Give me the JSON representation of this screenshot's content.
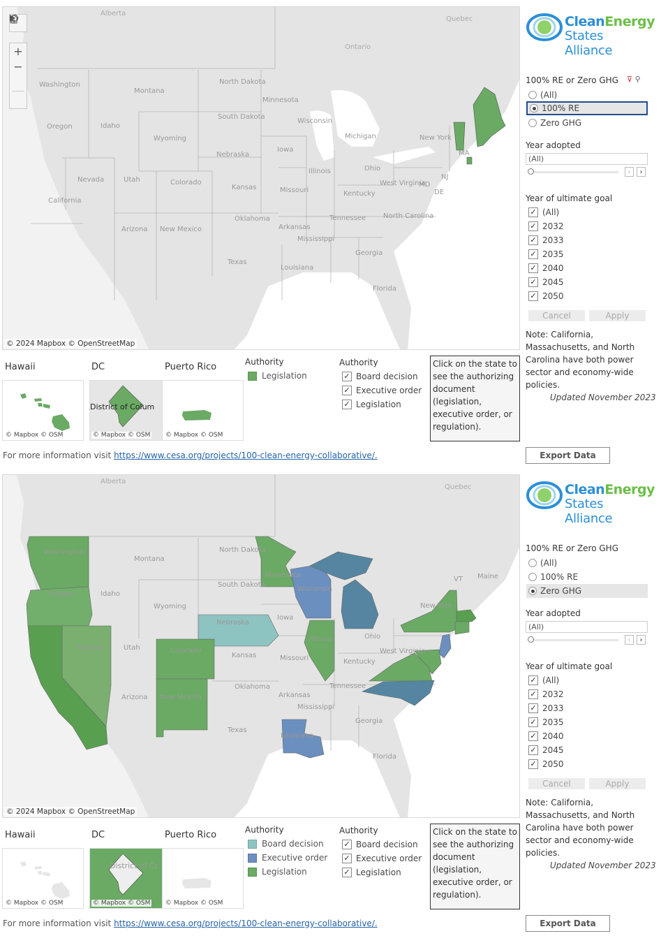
{
  "colors": {
    "legislation": "#6aaa64",
    "legislation_dark": "#58a04f",
    "executive_order": "#6b8fbf",
    "executive_order_dark": "#5585a0",
    "board_decision": "#8dc3c0",
    "map_land": "#e4e4e4",
    "map_water": "#ffffff",
    "link": "#2563a8",
    "selected_border": "#1f4e8c",
    "logo_blue": "#2c8fd6",
    "logo_green": "#6bbf47"
  },
  "logo": {
    "line1_a": "Clean",
    "line1_b": "Energy",
    "line2": "States Alliance"
  },
  "map": {
    "attribution": "© 2024 Mapbox © OpenStreetMap",
    "controls": [
      "search-icon",
      "zoom-in",
      "zoom-out",
      "home-icon",
      "play-icon"
    ],
    "country_labels": [
      "Alberta",
      "Ontario",
      "Quebec"
    ],
    "state_labels": [
      "Washington",
      "Oregon",
      "California",
      "Montana",
      "Idaho",
      "Nevada",
      "Utah",
      "Arizona",
      "Wyoming",
      "Colorado",
      "New Mexico",
      "North Dakota",
      "South Dakota",
      "Nebraska",
      "Kansas",
      "Oklahoma",
      "Texas",
      "Minnesota",
      "Iowa",
      "Missouri",
      "Arkansas",
      "Louisiana",
      "Wisconsin",
      "Illinois",
      "Michigan",
      "Ohio",
      "Kentucky",
      "Tennessee",
      "Mississippi",
      "Georgia",
      "Florida",
      "West Virginia",
      "North Carolina",
      "New York",
      "MA",
      "NJ",
      "MD",
      "DE",
      "VT",
      "Maine"
    ]
  },
  "filters": {
    "policy_type": {
      "title": "100% RE or Zero GHG",
      "options": [
        "(All)",
        "100% RE",
        "Zero GHG"
      ]
    },
    "year_adopted": {
      "title": "Year adopted",
      "value": "(All)",
      "slider_position": 0
    },
    "year_goal": {
      "title": "Year of ultimate goal",
      "options": [
        "(All)",
        "2032",
        "2033",
        "2035",
        "2040",
        "2045",
        "2050"
      ],
      "all_checked": true
    },
    "cancel_label": "Cancel",
    "apply_label": "Apply"
  },
  "note": "Note:  California, Massachusetts, and North Carolina have both power sector and economy-wide policies.",
  "updated": "Updated November 2023",
  "export_label": "Export Data",
  "insets": {
    "hawaii": "Hawaii",
    "dc": "DC",
    "puerto_rico": "Puerto Rico",
    "attribution": "© Mapbox  © OSM",
    "dc_label_1": "District of Colum",
    "dc_label_2": "District of Columbia"
  },
  "authority_filter": {
    "title": "Authority",
    "options": [
      "Board decision",
      "Executive order",
      "Legislation"
    ]
  },
  "info_box": "Click on the state to see the authorizing document (legislation, executive order, or regulation).",
  "more_info": {
    "prefix": "For more information visit ",
    "link": "https://www.cesa.org/projects/100-clean-energy-collaborative/."
  },
  "panels": [
    {
      "selected_policy": "100% RE",
      "legend_title": "Authority",
      "legend": [
        {
          "label": "Legislation",
          "color": "#6aaa64"
        }
      ],
      "highlighted_states": [
        {
          "state": "Maine",
          "authority": "Legislation"
        },
        {
          "state": "Vermont",
          "authority": "Legislation"
        },
        {
          "state": "Rhode Island",
          "authority": "Legislation"
        }
      ],
      "insets_highlighted": {
        "hawaii": true,
        "dc": true,
        "puerto_rico": true
      }
    },
    {
      "selected_policy": "Zero GHG",
      "legend_title": "Authority",
      "legend": [
        {
          "label": "Board decision",
          "color": "#8dc3c0"
        },
        {
          "label": "Executive order",
          "color": "#6b8fbf"
        },
        {
          "label": "Legislation",
          "color": "#6aaa64"
        }
      ],
      "highlighted_states": [
        {
          "state": "Washington",
          "authority": "Legislation"
        },
        {
          "state": "Oregon",
          "authority": "Legislation"
        },
        {
          "state": "California",
          "authority": "Legislation"
        },
        {
          "state": "Nevada",
          "authority": "Legislation"
        },
        {
          "state": "Colorado",
          "authority": "Legislation"
        },
        {
          "state": "New Mexico",
          "authority": "Legislation"
        },
        {
          "state": "Nebraska",
          "authority": "Board decision"
        },
        {
          "state": "Minnesota",
          "authority": "Legislation"
        },
        {
          "state": "Wisconsin",
          "authority": "Executive order"
        },
        {
          "state": "Michigan",
          "authority": "Executive order"
        },
        {
          "state": "Illinois",
          "authority": "Legislation"
        },
        {
          "state": "Louisiana",
          "authority": "Executive order"
        },
        {
          "state": "New York",
          "authority": "Legislation"
        },
        {
          "state": "Massachusetts",
          "authority": "Legislation"
        },
        {
          "state": "Connecticut",
          "authority": "Legislation"
        },
        {
          "state": "New Jersey",
          "authority": "Executive order"
        },
        {
          "state": "Maryland",
          "authority": "Legislation"
        },
        {
          "state": "Delaware",
          "authority": "Legislation"
        },
        {
          "state": "Virginia",
          "authority": "Legislation"
        },
        {
          "state": "North Carolina",
          "authority": "Executive order"
        }
      ],
      "insets_highlighted": {
        "hawaii": false,
        "dc": true,
        "puerto_rico": false
      }
    }
  ]
}
